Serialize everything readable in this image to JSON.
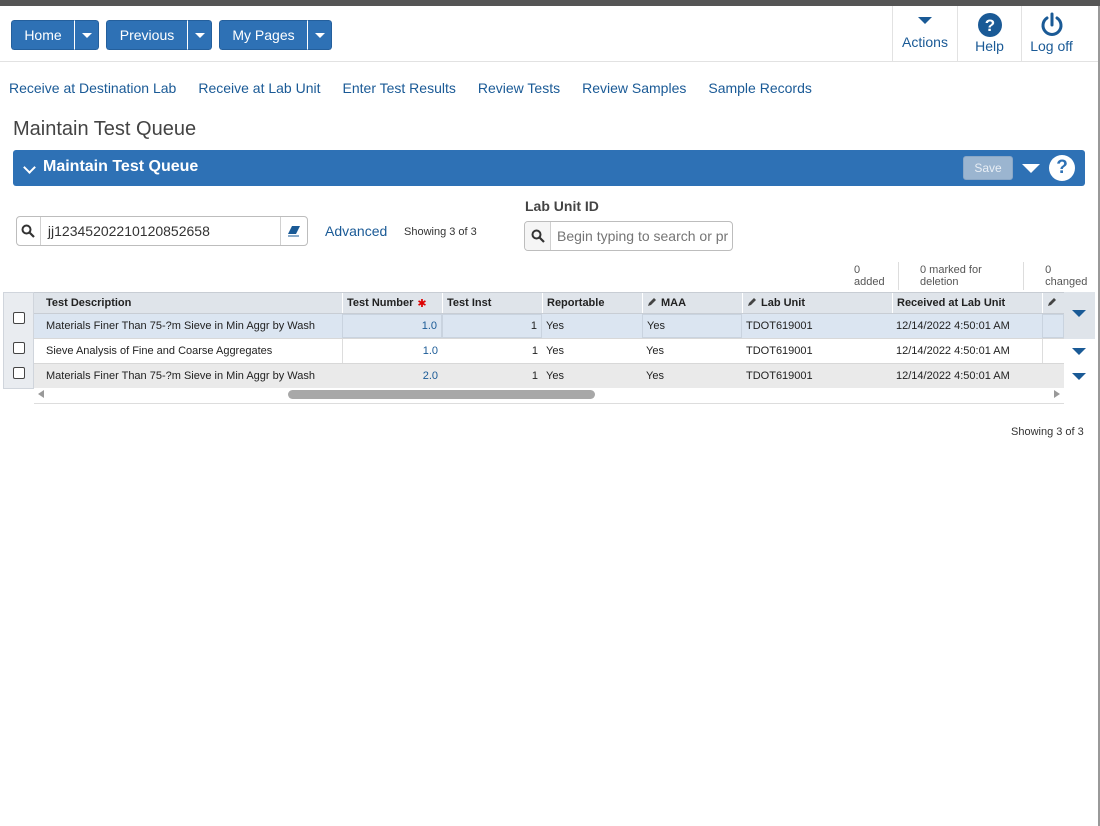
{
  "nav": {
    "home_label": "Home",
    "previous_label": "Previous",
    "mypages_label": "My Pages"
  },
  "tools": {
    "actions_label": "Actions",
    "help_label": "Help",
    "logoff_label": "Log off"
  },
  "quick_links": [
    "Receive at Destination Lab",
    "Receive at Lab Unit",
    "Enter Test Results",
    "Review Tests",
    "Review Samples",
    "Sample Records"
  ],
  "page_title": "Maintain Test Queue",
  "panel": {
    "title": "Maintain Test Queue",
    "save_label": "Save",
    "help_glyph": "?"
  },
  "search": {
    "value": "jj12345202210120852658",
    "advanced_label": "Advanced",
    "showing_text": "Showing 3 of 3"
  },
  "lab_unit": {
    "label": "Lab Unit ID",
    "placeholder": "Begin typing to search or pr"
  },
  "counts": {
    "added": "0 added",
    "marked": "0 marked for deletion",
    "changed": "0 changed"
  },
  "table": {
    "headers": {
      "description": "Test Description",
      "number": "Test Number",
      "inst": "Test Inst",
      "reportable": "Reportable",
      "maa": "MAA",
      "lab_unit": "Lab Unit",
      "received": "Received at Lab Unit"
    },
    "rows": [
      {
        "description": "Materials Finer Than 75-?m Sieve in Min Aggr by Wash",
        "number": "1.0",
        "inst": "1",
        "reportable": "Yes",
        "maa": "Yes",
        "lab_unit": "TDOT619001",
        "received": "12/14/2022 4:50:01 AM"
      },
      {
        "description": "Sieve Analysis of Fine and Coarse Aggregates",
        "number": "1.0",
        "inst": "1",
        "reportable": "Yes",
        "maa": "Yes",
        "lab_unit": "TDOT619001",
        "received": "12/14/2022 4:50:01 AM"
      },
      {
        "description": "Materials Finer Than 75-?m Sieve in Min Aggr by Wash",
        "number": "2.0",
        "inst": "1",
        "reportable": "Yes",
        "maa": "Yes",
        "lab_unit": "TDOT619001",
        "received": "12/14/2022 4:50:01 AM"
      }
    ]
  },
  "showing_bottom": "Showing 3 of 3",
  "colors": {
    "primary": "#2e71b5",
    "link": "#1a5a96",
    "required": "#dd0000"
  },
  "icons": [
    "search-icon",
    "eraser-icon",
    "caret-down-icon",
    "help-icon",
    "power-icon",
    "pencil-icon",
    "chevron-down-icon"
  ]
}
